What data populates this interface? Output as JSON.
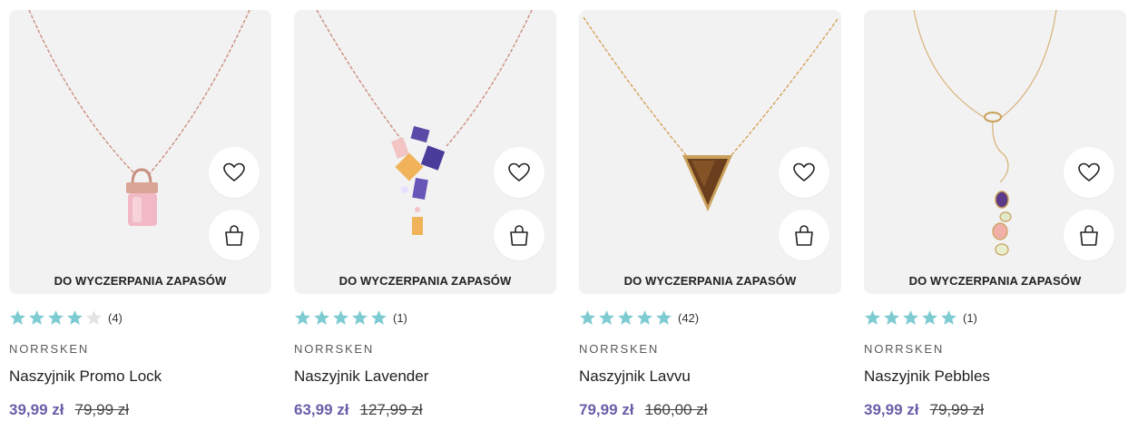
{
  "colors": {
    "star_filled": "#7fcbd2",
    "star_empty": "#e4e4e4",
    "price_now": "#6b5ea8",
    "card_bg": "#f3f2f2"
  },
  "icons": {
    "wishlist": "heart-icon",
    "cart": "shopping-bag-icon",
    "rating": "star-icon"
  },
  "products": [
    {
      "stock_label": "DO WYCZERPANIA ZAPASÓW",
      "rating": 4,
      "reviews": "(4)",
      "brand": "NORRSKEN",
      "name": "Naszyjnik Promo Lock",
      "price_now": "39,99 zł",
      "price_old": "79,99 zł"
    },
    {
      "stock_label": "DO WYCZERPANIA ZAPASÓW",
      "rating": 5,
      "reviews": "(1)",
      "brand": "NORRSKEN",
      "name": "Naszyjnik Lavender",
      "price_now": "63,99 zł",
      "price_old": "127,99 zł"
    },
    {
      "stock_label": "DO WYCZERPANIA ZAPASÓW",
      "rating": 5,
      "reviews": "(42)",
      "brand": "NORRSKEN",
      "name": "Naszyjnik Lavvu",
      "price_now": "79,99 zł",
      "price_old": "160,00 zł"
    },
    {
      "stock_label": "DO WYCZERPANIA ZAPASÓW",
      "rating": 5,
      "reviews": "(1)",
      "brand": "NORRSKEN",
      "name": "Naszyjnik Pebbles",
      "price_now": "39,99 zł",
      "price_old": "79,99 zł"
    }
  ]
}
